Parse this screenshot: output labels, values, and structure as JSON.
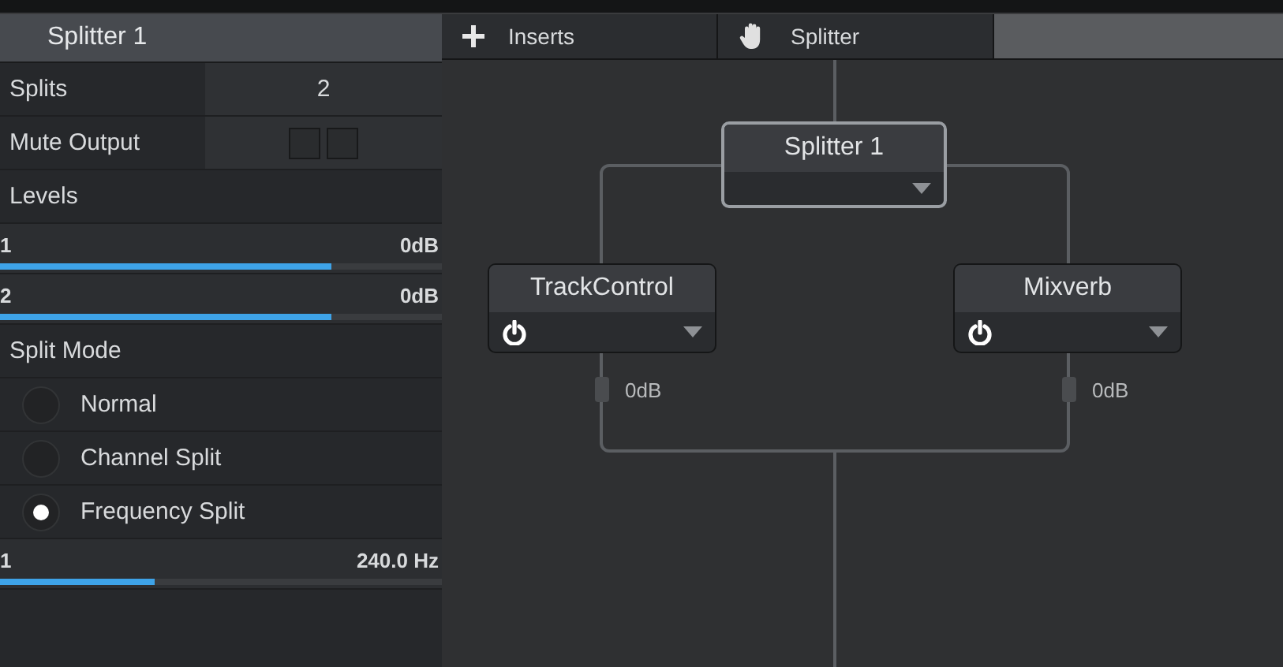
{
  "panel": {
    "title": "Splitter 1",
    "splits": {
      "label": "Splits",
      "value": "2"
    },
    "mute_output": {
      "label": "Mute Output",
      "outputs": [
        {
          "checked": false
        },
        {
          "checked": false
        }
      ]
    },
    "levels": {
      "label": "Levels",
      "channels": [
        {
          "name": "1",
          "reading": "0dB",
          "level": 0.75
        },
        {
          "name": "2",
          "reading": "0dB",
          "level": 0.75
        }
      ]
    },
    "split_mode": {
      "label": "Split Mode",
      "options": [
        {
          "label": "Normal",
          "selected": false
        },
        {
          "label": "Channel Split",
          "selected": false
        },
        {
          "label": "Frequency Split",
          "selected": true
        }
      ]
    },
    "frequencies": [
      {
        "name": "1",
        "reading": "240.0 Hz",
        "level": 0.35
      }
    ]
  },
  "tabs": [
    {
      "label": "Inserts",
      "kind": "add"
    },
    {
      "label": "Splitter",
      "kind": "hand"
    }
  ],
  "diagram": {
    "splitter": {
      "name": "Splitter 1"
    },
    "plugins": [
      {
        "name": "TrackControl",
        "gain": "0dB"
      },
      {
        "name": "Mixverb",
        "gain": "0dB"
      }
    ]
  }
}
